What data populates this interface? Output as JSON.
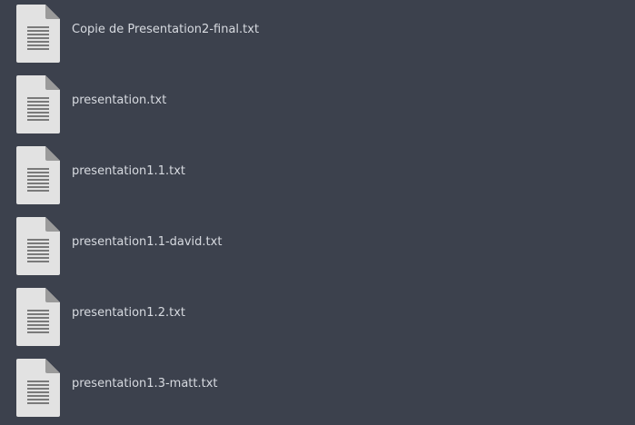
{
  "files": [
    {
      "name": "Copie de Presentation2-final.txt",
      "icon": "text-file-icon"
    },
    {
      "name": "presentation.txt",
      "icon": "text-file-icon"
    },
    {
      "name": "presentation1.1.txt",
      "icon": "text-file-icon"
    },
    {
      "name": "presentation1.1-david.txt",
      "icon": "text-file-icon"
    },
    {
      "name": "presentation1.2.txt",
      "icon": "text-file-icon"
    },
    {
      "name": "presentation1.3-matt.txt",
      "icon": "text-file-icon"
    }
  ],
  "colors": {
    "background": "#3c414d",
    "text": "#d7dae0",
    "icon_page": "#e2e2e2",
    "icon_fold": "#9a9a9a",
    "icon_lines": "#7a7a7a"
  }
}
